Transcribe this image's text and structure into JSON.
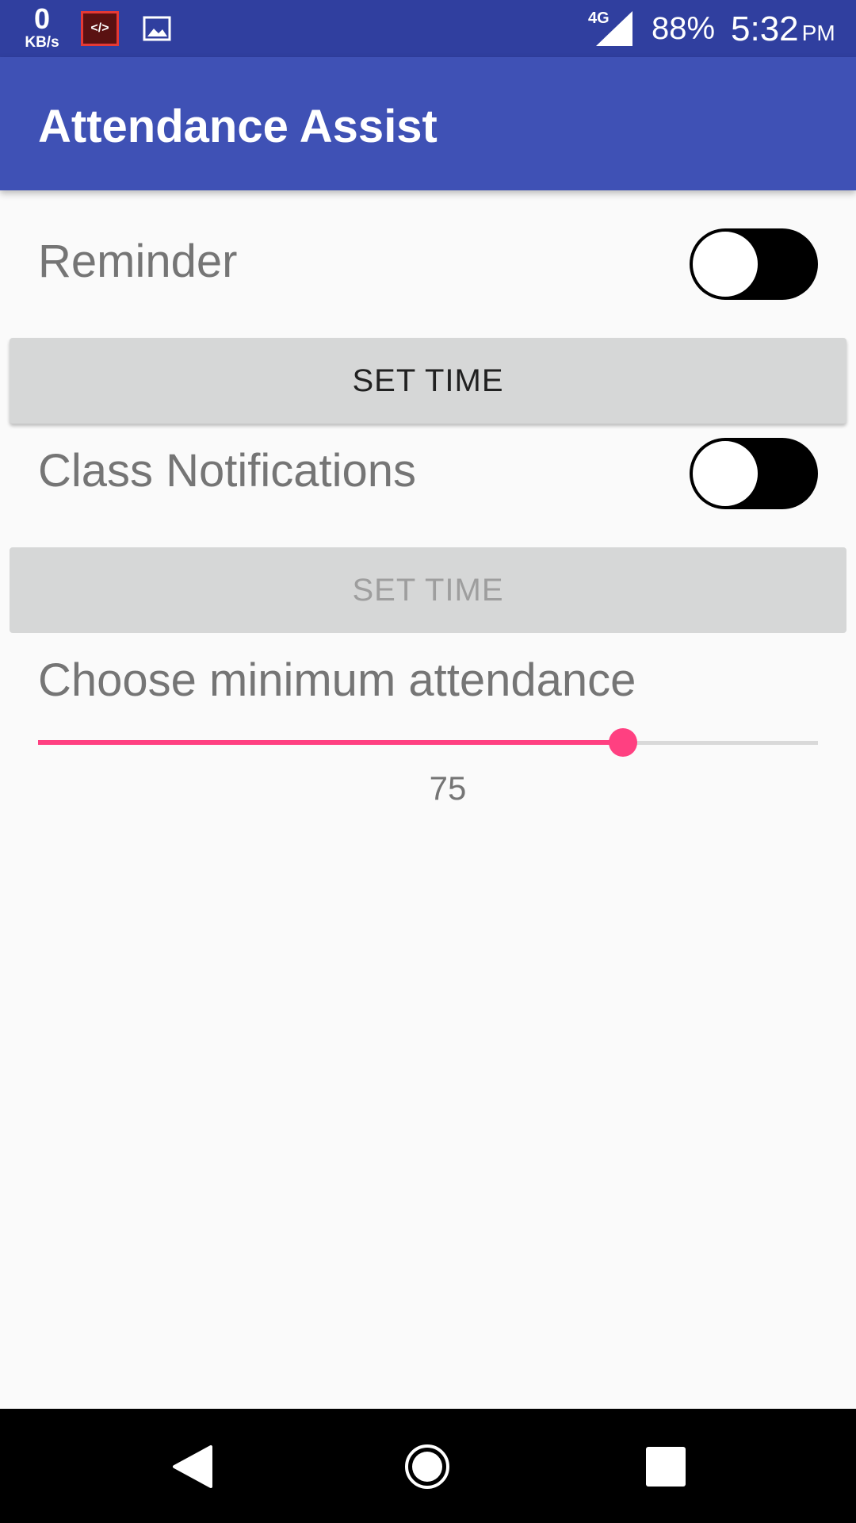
{
  "status_bar": {
    "net_speed_value": "0",
    "net_speed_unit": "KB/s",
    "code_icon_text": "</>",
    "network_type": "4G",
    "battery": "88%",
    "time": "5:32",
    "ampm": "PM",
    "icons": [
      "code-notification-icon",
      "image-notification-icon",
      "signal-icon"
    ]
  },
  "app_bar": {
    "title": "Attendance Assist"
  },
  "settings": {
    "reminder": {
      "label": "Reminder",
      "toggle_on": false,
      "button_label": "SET TIME",
      "button_enabled": true
    },
    "class_notifications": {
      "label": "Class Notifications",
      "toggle_on": false,
      "button_label": "SET TIME",
      "button_enabled": false
    },
    "minimum_attendance": {
      "label": "Choose minimum attendance",
      "value": "75",
      "min": 0,
      "max": 100,
      "accent_color": "#ff4081"
    }
  },
  "nav_bar": {
    "icons": [
      "back-icon",
      "home-icon",
      "recents-icon"
    ]
  },
  "colors": {
    "primary": "#3f51b5",
    "primary_dark": "#303f9f",
    "accent": "#ff4081"
  }
}
